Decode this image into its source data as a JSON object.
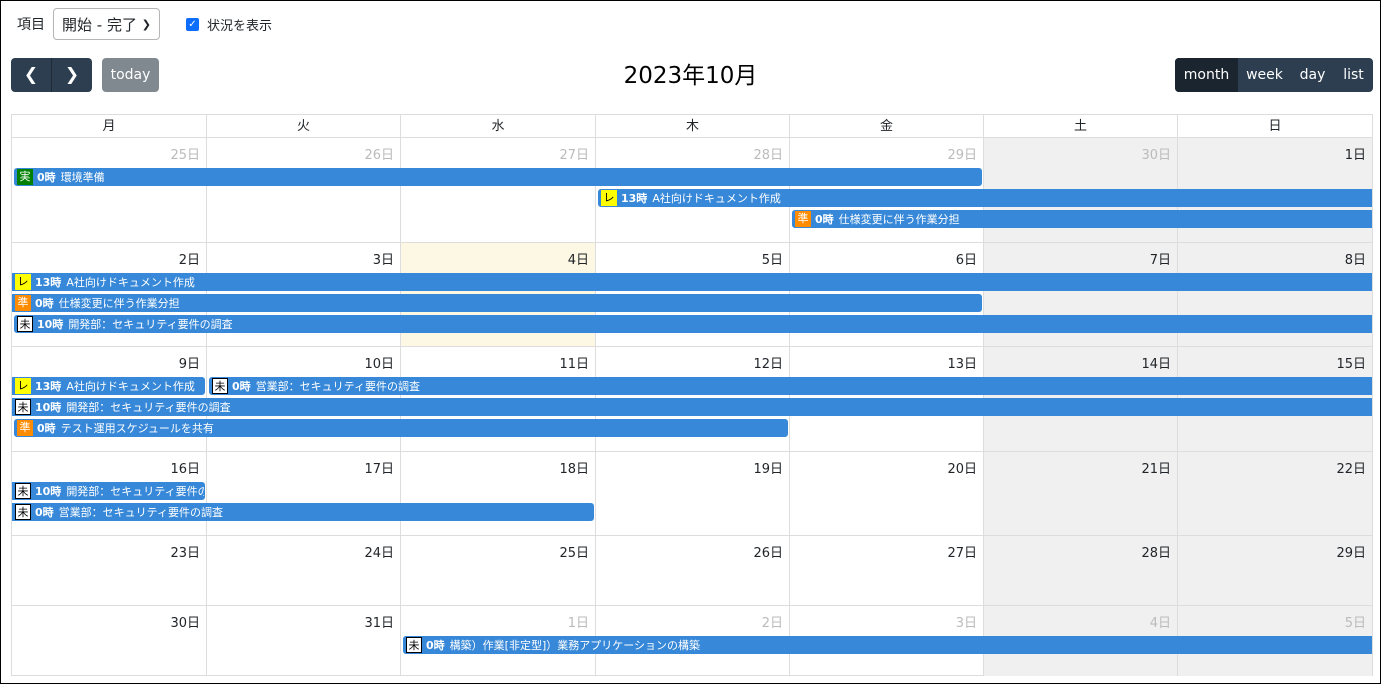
{
  "toolbar": {
    "item_label": "項目",
    "select_value": "開始 - 完了",
    "show_status_label": "状況を表示",
    "today_label": "today",
    "title": "2023年10月",
    "views": [
      {
        "label": "month",
        "active": true
      },
      {
        "label": "week",
        "active": false
      },
      {
        "label": "day",
        "active": false
      },
      {
        "label": "list",
        "active": false
      }
    ]
  },
  "weekdays": [
    "月",
    "火",
    "水",
    "木",
    "金",
    "土",
    "日"
  ],
  "weeks": [
    [
      {
        "label": "25日",
        "other": true
      },
      {
        "label": "26日",
        "other": true
      },
      {
        "label": "27日",
        "other": true
      },
      {
        "label": "28日",
        "other": true
      },
      {
        "label": "29日",
        "other": true
      },
      {
        "label": "30日",
        "other": true
      },
      {
        "label": "1日",
        "other": false
      }
    ],
    [
      {
        "label": "2日",
        "other": false
      },
      {
        "label": "3日",
        "other": false
      },
      {
        "label": "4日",
        "other": false,
        "today": true
      },
      {
        "label": "5日",
        "other": false
      },
      {
        "label": "6日",
        "other": false
      },
      {
        "label": "7日",
        "other": false
      },
      {
        "label": "8日",
        "other": false
      }
    ],
    [
      {
        "label": "9日",
        "other": false
      },
      {
        "label": "10日",
        "other": false
      },
      {
        "label": "11日",
        "other": false
      },
      {
        "label": "12日",
        "other": false
      },
      {
        "label": "13日",
        "other": false
      },
      {
        "label": "14日",
        "other": false
      },
      {
        "label": "15日",
        "other": false
      }
    ],
    [
      {
        "label": "16日",
        "other": false
      },
      {
        "label": "17日",
        "other": false
      },
      {
        "label": "18日",
        "other": false
      },
      {
        "label": "19日",
        "other": false
      },
      {
        "label": "20日",
        "other": false
      },
      {
        "label": "21日",
        "other": false
      },
      {
        "label": "22日",
        "other": false
      }
    ],
    [
      {
        "label": "23日",
        "other": false
      },
      {
        "label": "24日",
        "other": false
      },
      {
        "label": "25日",
        "other": false
      },
      {
        "label": "26日",
        "other": false
      },
      {
        "label": "27日",
        "other": false
      },
      {
        "label": "28日",
        "other": false
      },
      {
        "label": "29日",
        "other": false
      }
    ],
    [
      {
        "label": "30日",
        "other": false
      },
      {
        "label": "31日",
        "other": false
      },
      {
        "label": "1日",
        "other": true
      },
      {
        "label": "2日",
        "other": true
      },
      {
        "label": "3日",
        "other": true
      },
      {
        "label": "4日",
        "other": true
      },
      {
        "label": "5日",
        "other": true
      }
    ]
  ],
  "events": [
    {
      "week": 0,
      "lane": 0,
      "start": 0,
      "end": 4,
      "badge": "実",
      "status": "jitsu",
      "time": "0時",
      "title": "環境準備"
    },
    {
      "week": 0,
      "lane": 1,
      "start": 3,
      "end": 6,
      "badge": "レ",
      "status": "re",
      "time": "13時",
      "title": "A社向けドキュメント作成",
      "cont_right": true
    },
    {
      "week": 0,
      "lane": 2,
      "start": 4,
      "end": 6,
      "badge": "準",
      "status": "jun",
      "time": "0時",
      "title": "仕様変更に伴う作業分担",
      "cont_right": true
    },
    {
      "week": 1,
      "lane": 0,
      "start": 0,
      "end": 6,
      "badge": "レ",
      "status": "re",
      "time": "13時",
      "title": "A社向けドキュメント作成",
      "cont_left": true,
      "cont_right": true
    },
    {
      "week": 1,
      "lane": 1,
      "start": 0,
      "end": 4,
      "badge": "準",
      "status": "jun",
      "time": "0時",
      "title": "仕様変更に伴う作業分担",
      "cont_left": true
    },
    {
      "week": 1,
      "lane": 2,
      "start": 0,
      "end": 6,
      "badge": "未",
      "status": "mi",
      "time": "10時",
      "title": "開発部：セキュリティ要件の調査",
      "cont_right": true
    },
    {
      "week": 2,
      "lane": 0,
      "start": 0,
      "end": 0,
      "badge": "レ",
      "status": "re",
      "time": "13時",
      "title": "A社向けドキュメント作成",
      "cont_left": true
    },
    {
      "week": 2,
      "lane": 0,
      "start": 1,
      "end": 6,
      "badge": "未",
      "status": "mi",
      "time": "0時",
      "title": "営業部：セキュリティ要件の調査",
      "cont_right": true
    },
    {
      "week": 2,
      "lane": 1,
      "start": 0,
      "end": 6,
      "badge": "未",
      "status": "mi",
      "time": "10時",
      "title": "開発部：セキュリティ要件の調査",
      "cont_left": true,
      "cont_right": true
    },
    {
      "week": 2,
      "lane": 2,
      "start": 0,
      "end": 3,
      "badge": "準",
      "status": "jun",
      "time": "0時",
      "title": "テスト運用スケジュールを共有"
    },
    {
      "week": 3,
      "lane": 0,
      "start": 0,
      "end": 0,
      "badge": "未",
      "status": "mi",
      "time": "10時",
      "title": "開発部：セキュリティ要件の調査",
      "cont_left": true
    },
    {
      "week": 3,
      "lane": 1,
      "start": 0,
      "end": 2,
      "badge": "未",
      "status": "mi",
      "time": "0時",
      "title": "営業部：セキュリティ要件の調査",
      "cont_left": true
    },
    {
      "week": 5,
      "lane": 0,
      "start": 2,
      "end": 6,
      "badge": "未",
      "status": "mi",
      "time": "0時",
      "title": "構築）作業[非定型]）業務アプリケーションの構築",
      "cont_right": true
    }
  ]
}
